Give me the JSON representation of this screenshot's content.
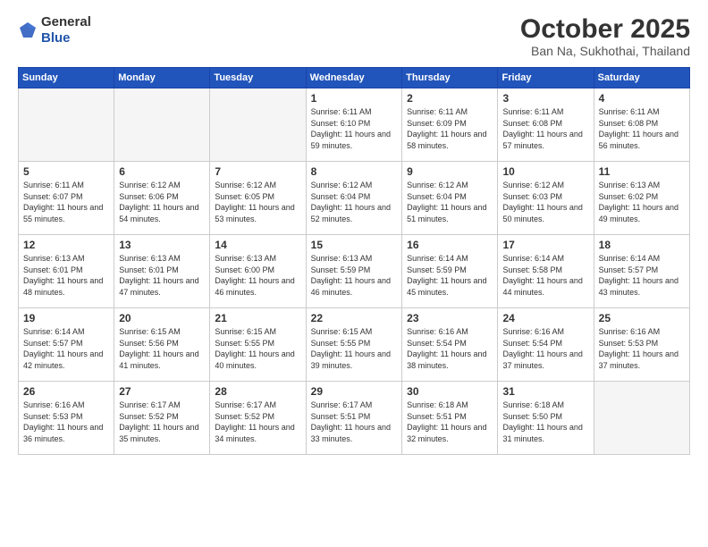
{
  "header": {
    "logo_general": "General",
    "logo_blue": "Blue",
    "month": "October 2025",
    "location": "Ban Na, Sukhothai, Thailand"
  },
  "weekdays": [
    "Sunday",
    "Monday",
    "Tuesday",
    "Wednesday",
    "Thursday",
    "Friday",
    "Saturday"
  ],
  "weeks": [
    [
      {
        "day": "",
        "empty": true
      },
      {
        "day": "",
        "empty": true
      },
      {
        "day": "",
        "empty": true
      },
      {
        "day": "1",
        "sunrise": "6:11 AM",
        "sunset": "6:10 PM",
        "daylight": "11 hours and 59 minutes."
      },
      {
        "day": "2",
        "sunrise": "6:11 AM",
        "sunset": "6:09 PM",
        "daylight": "11 hours and 58 minutes."
      },
      {
        "day": "3",
        "sunrise": "6:11 AM",
        "sunset": "6:08 PM",
        "daylight": "11 hours and 57 minutes."
      },
      {
        "day": "4",
        "sunrise": "6:11 AM",
        "sunset": "6:08 PM",
        "daylight": "11 hours and 56 minutes."
      }
    ],
    [
      {
        "day": "5",
        "sunrise": "6:11 AM",
        "sunset": "6:07 PM",
        "daylight": "11 hours and 55 minutes."
      },
      {
        "day": "6",
        "sunrise": "6:12 AM",
        "sunset": "6:06 PM",
        "daylight": "11 hours and 54 minutes."
      },
      {
        "day": "7",
        "sunrise": "6:12 AM",
        "sunset": "6:05 PM",
        "daylight": "11 hours and 53 minutes."
      },
      {
        "day": "8",
        "sunrise": "6:12 AM",
        "sunset": "6:04 PM",
        "daylight": "11 hours and 52 minutes."
      },
      {
        "day": "9",
        "sunrise": "6:12 AM",
        "sunset": "6:04 PM",
        "daylight": "11 hours and 51 minutes."
      },
      {
        "day": "10",
        "sunrise": "6:12 AM",
        "sunset": "6:03 PM",
        "daylight": "11 hours and 50 minutes."
      },
      {
        "day": "11",
        "sunrise": "6:13 AM",
        "sunset": "6:02 PM",
        "daylight": "11 hours and 49 minutes."
      }
    ],
    [
      {
        "day": "12",
        "sunrise": "6:13 AM",
        "sunset": "6:01 PM",
        "daylight": "11 hours and 48 minutes."
      },
      {
        "day": "13",
        "sunrise": "6:13 AM",
        "sunset": "6:01 PM",
        "daylight": "11 hours and 47 minutes."
      },
      {
        "day": "14",
        "sunrise": "6:13 AM",
        "sunset": "6:00 PM",
        "daylight": "11 hours and 46 minutes."
      },
      {
        "day": "15",
        "sunrise": "6:13 AM",
        "sunset": "5:59 PM",
        "daylight": "11 hours and 46 minutes."
      },
      {
        "day": "16",
        "sunrise": "6:14 AM",
        "sunset": "5:59 PM",
        "daylight": "11 hours and 45 minutes."
      },
      {
        "day": "17",
        "sunrise": "6:14 AM",
        "sunset": "5:58 PM",
        "daylight": "11 hours and 44 minutes."
      },
      {
        "day": "18",
        "sunrise": "6:14 AM",
        "sunset": "5:57 PM",
        "daylight": "11 hours and 43 minutes."
      }
    ],
    [
      {
        "day": "19",
        "sunrise": "6:14 AM",
        "sunset": "5:57 PM",
        "daylight": "11 hours and 42 minutes."
      },
      {
        "day": "20",
        "sunrise": "6:15 AM",
        "sunset": "5:56 PM",
        "daylight": "11 hours and 41 minutes."
      },
      {
        "day": "21",
        "sunrise": "6:15 AM",
        "sunset": "5:55 PM",
        "daylight": "11 hours and 40 minutes."
      },
      {
        "day": "22",
        "sunrise": "6:15 AM",
        "sunset": "5:55 PM",
        "daylight": "11 hours and 39 minutes."
      },
      {
        "day": "23",
        "sunrise": "6:16 AM",
        "sunset": "5:54 PM",
        "daylight": "11 hours and 38 minutes."
      },
      {
        "day": "24",
        "sunrise": "6:16 AM",
        "sunset": "5:54 PM",
        "daylight": "11 hours and 37 minutes."
      },
      {
        "day": "25",
        "sunrise": "6:16 AM",
        "sunset": "5:53 PM",
        "daylight": "11 hours and 37 minutes."
      }
    ],
    [
      {
        "day": "26",
        "sunrise": "6:16 AM",
        "sunset": "5:53 PM",
        "daylight": "11 hours and 36 minutes."
      },
      {
        "day": "27",
        "sunrise": "6:17 AM",
        "sunset": "5:52 PM",
        "daylight": "11 hours and 35 minutes."
      },
      {
        "day": "28",
        "sunrise": "6:17 AM",
        "sunset": "5:52 PM",
        "daylight": "11 hours and 34 minutes."
      },
      {
        "day": "29",
        "sunrise": "6:17 AM",
        "sunset": "5:51 PM",
        "daylight": "11 hours and 33 minutes."
      },
      {
        "day": "30",
        "sunrise": "6:18 AM",
        "sunset": "5:51 PM",
        "daylight": "11 hours and 32 minutes."
      },
      {
        "day": "31",
        "sunrise": "6:18 AM",
        "sunset": "5:50 PM",
        "daylight": "11 hours and 31 minutes."
      },
      {
        "day": "",
        "empty": true
      }
    ]
  ]
}
